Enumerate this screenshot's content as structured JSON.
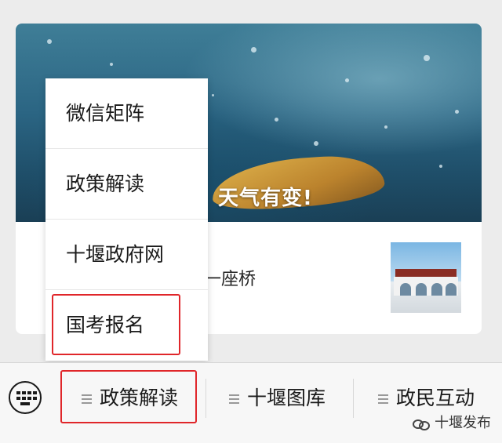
{
  "article": {
    "cover_title": "天气有变!",
    "sub_title_fragment": "一座桥"
  },
  "popup_menu": {
    "items": [
      {
        "label": "微信矩阵"
      },
      {
        "label": "政策解读"
      },
      {
        "label": "十堰政府网"
      },
      {
        "label": "国考报名"
      }
    ],
    "highlighted_index": 3
  },
  "bottom_menu": {
    "tabs": [
      {
        "label": "政策解读"
      },
      {
        "label": "十堰图库"
      },
      {
        "label": "政民互动"
      }
    ],
    "highlight_color": "#e0262a"
  },
  "watermark": {
    "text": "十堰发布"
  }
}
